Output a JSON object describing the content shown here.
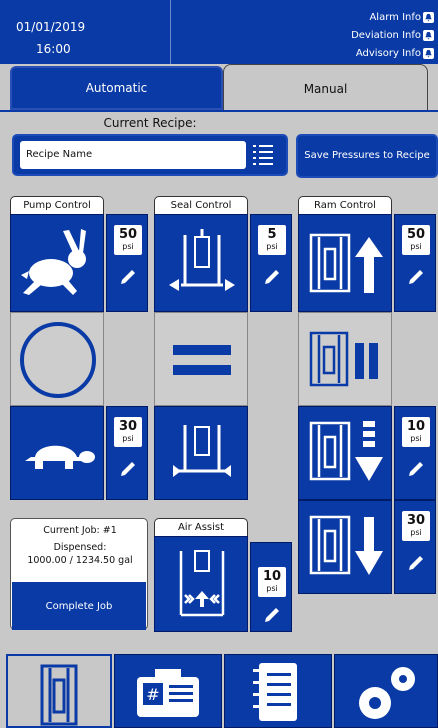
{
  "header": {
    "date": "01/01/2019",
    "time": "16:00",
    "alarm_info": "Alarm Info",
    "deviation_info": "Deviation Info",
    "advisory_info": "Advisory Info"
  },
  "tabs": {
    "automatic": "Automatic",
    "manual": "Manual"
  },
  "recipe": {
    "label": "Current Recipe:",
    "value": "Recipe Name",
    "save_button": "Save Pressures to Recipe"
  },
  "pump_control": {
    "title": "Pump Control",
    "fast_psi": "50",
    "slow_psi": "30",
    "unit": "psi"
  },
  "seal_control": {
    "title": "Seal Control",
    "psi": "5",
    "unit": "psi"
  },
  "ram_control": {
    "title": "Ram Control",
    "up_psi": "50",
    "down_psi": "10",
    "down2_psi": "30",
    "unit": "psi"
  },
  "job": {
    "current_job": "Current Job: #1",
    "dispensed_label": "Dispensed:",
    "dispensed_value": "1000.00 / 1234.50  gal",
    "complete_button": "Complete Job"
  },
  "air_assist": {
    "title": "Air Assist",
    "psi": "10",
    "unit": "psi"
  },
  "colors": {
    "primary": "#0a3aa5",
    "background": "#c8c8c8"
  },
  "bottom_nav": {
    "icons": [
      "ram-icon",
      "pump-unit-icon",
      "notebook-icon",
      "settings-gears-icon"
    ]
  }
}
